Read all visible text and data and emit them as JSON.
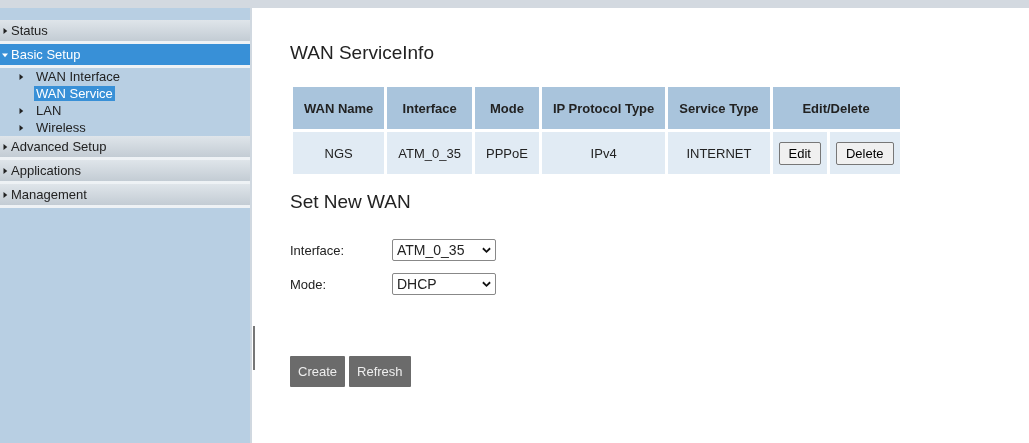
{
  "menu": [
    {
      "label": "Status",
      "kind": "group",
      "expanded": false,
      "selected": false
    },
    {
      "label": "Basic Setup",
      "kind": "group",
      "expanded": true,
      "selected": true,
      "children": [
        {
          "label": "WAN Interface",
          "kind": "group",
          "expanded": false,
          "selected": false
        },
        {
          "label": "WAN Service",
          "kind": "page",
          "selected": true
        },
        {
          "label": "LAN",
          "kind": "group",
          "expanded": false,
          "selected": false
        },
        {
          "label": "Wireless",
          "kind": "group",
          "expanded": false,
          "selected": false
        }
      ]
    },
    {
      "label": "Advanced Setup",
      "kind": "group",
      "expanded": false,
      "selected": false
    },
    {
      "label": "Applications",
      "kind": "group",
      "expanded": false,
      "selected": false
    },
    {
      "label": "Management",
      "kind": "group",
      "expanded": false,
      "selected": false
    }
  ],
  "title": "WAN ServiceInfo",
  "table": {
    "columns": [
      "WAN Name",
      "Interface",
      "Mode",
      "IP Protocol Type",
      "Service Type",
      "Edit/Delete"
    ],
    "rows": [
      {
        "cells": [
          "NGS",
          "ATM_0_35",
          "PPPoE",
          "IPv4",
          "INTERNET"
        ],
        "buttons": [
          "Edit",
          "Delete"
        ]
      }
    ]
  },
  "new_section": {
    "title": "Set New WAN",
    "fields": [
      {
        "label": "Interface:",
        "value": "ATM_0_35"
      },
      {
        "label": "Mode:",
        "value": "DHCP"
      }
    ],
    "buttons": [
      "Create",
      "Refresh"
    ]
  }
}
